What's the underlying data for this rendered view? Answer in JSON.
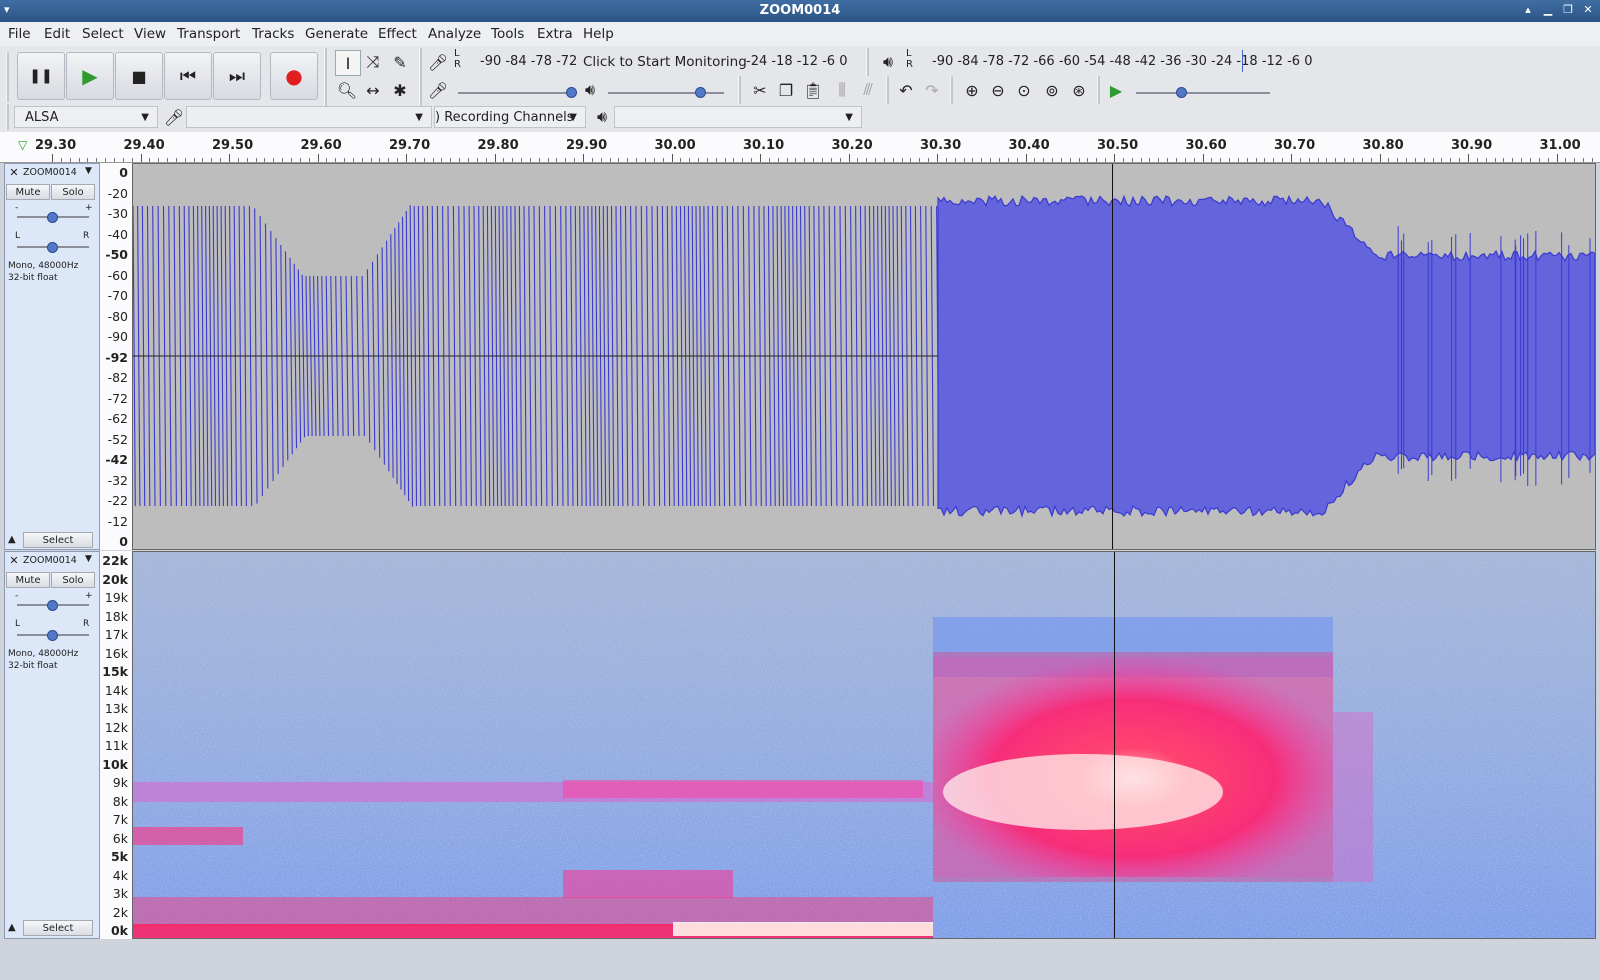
{
  "window": {
    "title": "ZOOM0014"
  },
  "menu": [
    "File",
    "Edit",
    "Select",
    "View",
    "Transport",
    "Tracks",
    "Generate",
    "Effect",
    "Analyze",
    "Tools",
    "Extra",
    "Help"
  ],
  "transport": {
    "pause": "❚❚",
    "play": "▶",
    "stop": "■",
    "skip_start": "⏮",
    "skip_end": "⏭",
    "record": "●"
  },
  "meters": {
    "record_scale_left": "-90 -84 -78 -72",
    "record_prompt": "Click to Start Monitoring",
    "record_scale_right": "-24 -18 -12  -6   0",
    "playback_scale": "-90 -84 -78 -72 -66 -60 -54 -48 -42 -36 -30 -24 -18 -12  -6   0",
    "lr_l": "L",
    "lr_r": "R"
  },
  "device": {
    "host": "ALSA",
    "input": "",
    "channels": ") Recording Channels",
    "output": ""
  },
  "ruler": {
    "ticks": [
      "29.30",
      "29.40",
      "29.50",
      "29.60",
      "29.70",
      "29.80",
      "29.90",
      "30.00",
      "30.10",
      "30.20",
      "30.30",
      "30.40",
      "30.50",
      "30.60",
      "30.70",
      "30.80",
      "30.90",
      "31.00"
    ]
  },
  "tracks": [
    {
      "name": "ZOOM0014",
      "mute": "Mute",
      "solo": "Solo",
      "gain_minus": "-",
      "gain_plus": "+",
      "pan_l": "L",
      "pan_r": "R",
      "info_line1": "Mono, 48000Hz",
      "info_line2": "32-bit float",
      "select": "Select",
      "scale": [
        "0",
        "-20",
        "-30",
        "-40",
        "-50",
        "-60",
        "-70",
        "-80",
        "-90",
        "-92",
        "-82",
        "-72",
        "-62",
        "-52",
        "-42",
        "-32",
        "-22",
        "-12",
        "0"
      ]
    },
    {
      "name": "ZOOM0014",
      "mute": "Mute",
      "solo": "Solo",
      "gain_minus": "-",
      "gain_plus": "+",
      "pan_l": "L",
      "pan_r": "R",
      "info_line1": "Mono, 48000Hz",
      "info_line2": "32-bit float",
      "select": "Select",
      "scale": [
        "22k",
        "20k",
        "19k",
        "18k",
        "17k",
        "16k",
        "15k",
        "14k",
        "13k",
        "12k",
        "11k",
        "10k",
        "9k",
        "8k",
        "7k",
        "6k",
        "5k",
        "4k",
        "3k",
        "2k",
        "0k"
      ]
    }
  ],
  "colors": {
    "waveform": "#3a3ad0",
    "waveform_fill": "#6464dc",
    "track_bg": "#bdbdbd",
    "spectro_bg": "#b6b9c8"
  }
}
